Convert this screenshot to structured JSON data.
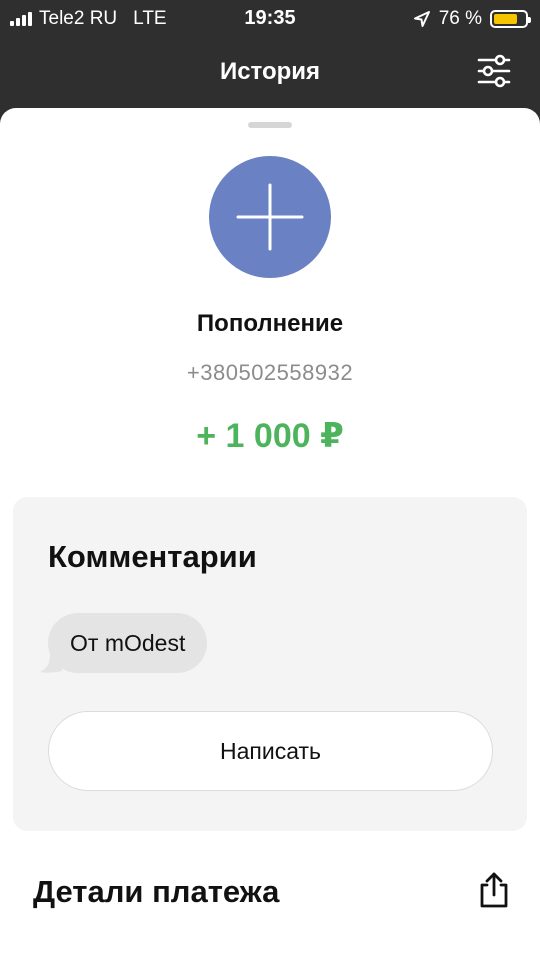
{
  "status_bar": {
    "carrier": "Tele2 RU",
    "network": "LTE",
    "time": "19:35",
    "battery_percent": "76 %",
    "battery_level": 0.76,
    "battery_color": "#f7c400",
    "icons": [
      "signal-icon",
      "location-arrow-icon",
      "battery-icon"
    ]
  },
  "header": {
    "title": "История",
    "filter_icon": "sliders-icon"
  },
  "operation": {
    "icon": "plus-icon",
    "avatar_color": "#6a82c3",
    "title": "Пополнение",
    "phone": "+380502558932",
    "amount": "+ 1 000 ₽",
    "amount_color": "#4db35d"
  },
  "comments": {
    "title": "Комментарии",
    "items": [
      "От mOdest"
    ],
    "write_label": "Написать"
  },
  "details": {
    "title": "Детали платежа",
    "share_icon": "share-icon"
  }
}
